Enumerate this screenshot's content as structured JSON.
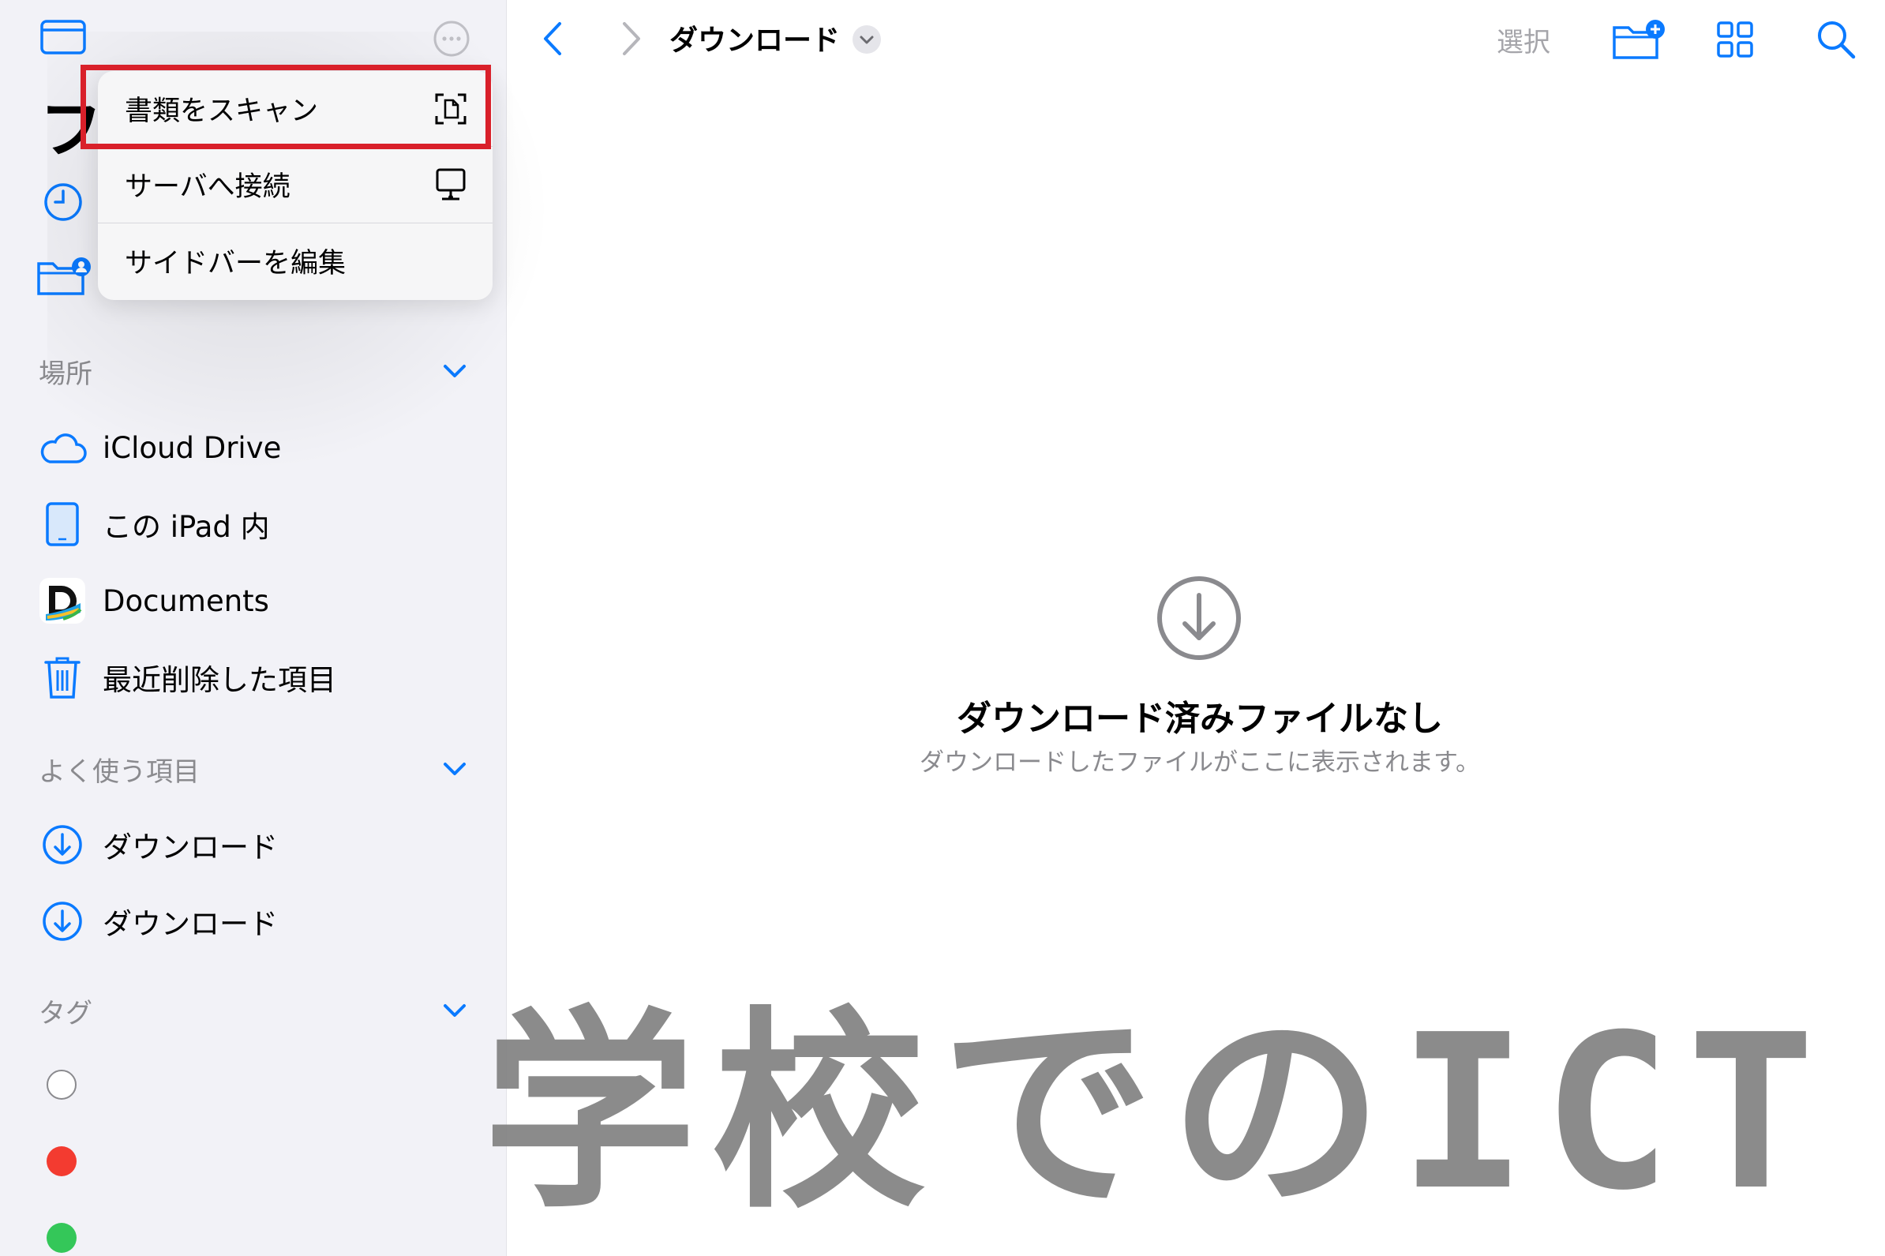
{
  "sidebar": {
    "title_partial": "フ",
    "sections": {
      "locations": {
        "header": "場所",
        "items": [
          {
            "label": "iCloud Drive",
            "icon": "icloud-icon"
          },
          {
            "label": "この iPad 内",
            "icon": "ipad-icon"
          },
          {
            "label": "Documents",
            "icon": "documents-app-icon"
          },
          {
            "label": "最近削除した項目",
            "icon": "trash-icon"
          }
        ]
      },
      "favorites": {
        "header": "よく使う項目",
        "items": [
          {
            "label": "ダウンロード",
            "icon": "download-circle-icon"
          },
          {
            "label": "ダウンロード",
            "icon": "download-circle-icon"
          }
        ]
      },
      "tags": {
        "header": "タグ",
        "items": [
          {
            "color": "#ffffff",
            "name": "tag-none"
          },
          {
            "color": "#f33b30",
            "name": "tag-red"
          },
          {
            "color": "#34c759",
            "name": "tag-green"
          }
        ]
      }
    }
  },
  "popup_menu": {
    "items": [
      {
        "label": "書類をスキャン",
        "icon": "document-scan-icon",
        "highlighted": true
      },
      {
        "label": "サーバへ接続",
        "icon": "server-display-icon"
      },
      {
        "label": "サイドバーを編集",
        "icon": ""
      }
    ],
    "highlight_color": "#d9202a"
  },
  "toolbar": {
    "title": "ダウンロード",
    "select_label": "選択"
  },
  "empty_state": {
    "title": "ダウンロード済みファイルなし",
    "subtitle": "ダウンロードしたファイルがここに表示されます。"
  },
  "watermark": "学校でのICT",
  "colors": {
    "accent": "#0a7aff",
    "sidebar_bg": "#f2f2f7",
    "secondary_text": "#8a8a8e"
  }
}
